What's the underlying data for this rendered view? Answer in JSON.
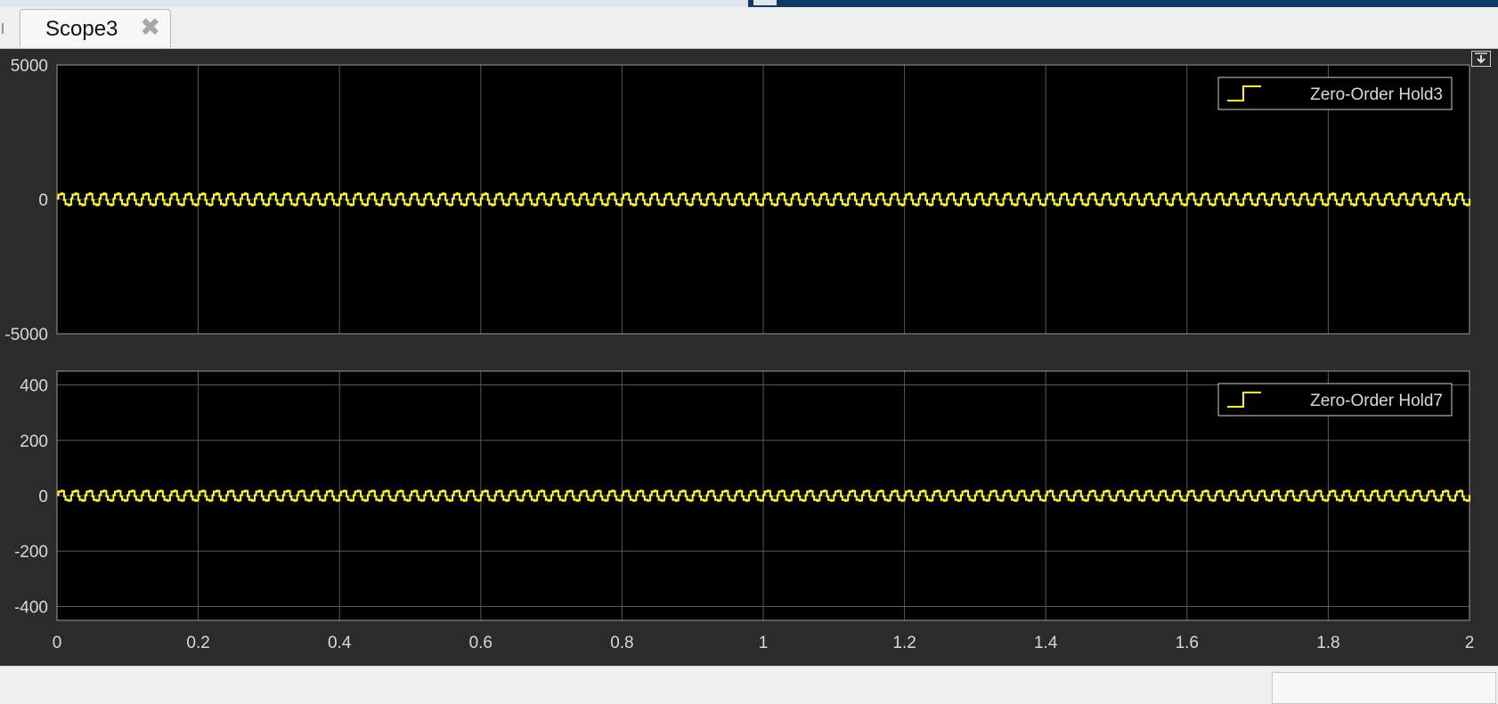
{
  "tab": {
    "title": "Scope3",
    "close_glyph": "✖"
  },
  "icons": {
    "close": "close-icon",
    "undock": "undock-icon",
    "legend_step": "step-line-icon"
  },
  "colors": {
    "plot_background": "#000000",
    "figure_background": "#2b2b2b",
    "signal": "#ffff33",
    "grid": "#5a5a5a",
    "axis_text": "#d9d9d9"
  },
  "chart_data": [
    {
      "type": "line",
      "title": "",
      "xlabel": "",
      "ylabel": "",
      "xlim": [
        0,
        2
      ],
      "ylim": [
        -5000,
        5000
      ],
      "x_ticks": [
        0,
        0.2,
        0.4,
        0.6,
        0.8,
        1,
        1.2,
        1.4,
        1.6,
        1.8,
        2
      ],
      "y_ticks": [
        5000,
        0,
        -5000
      ],
      "grid": true,
      "legend_position": "top-right",
      "series": [
        {
          "name": "Zero-Order Hold3",
          "style": "step",
          "description": "oscillation around 0",
          "amplitude": 300,
          "cycles": 100,
          "x_range": [
            0,
            2
          ]
        }
      ]
    },
    {
      "type": "line",
      "title": "",
      "xlabel": "",
      "ylabel": "",
      "xlim": [
        0,
        2
      ],
      "ylim": [
        -450,
        450
      ],
      "x_ticks": [
        0,
        0.2,
        0.4,
        0.6,
        0.8,
        1,
        1.2,
        1.4,
        1.6,
        1.8,
        2
      ],
      "x_tick_labels": [
        "0",
        "0.2",
        "0.4",
        "0.6",
        "0.8",
        "1",
        "1.2",
        "1.4",
        "1.6",
        "1.8",
        "2"
      ],
      "y_ticks": [
        400,
        200,
        0,
        -200,
        -400
      ],
      "grid": true,
      "legend_position": "top-right",
      "series": [
        {
          "name": "Zero-Order Hold7",
          "style": "step",
          "description": "oscillation around 0",
          "amplitude": 25,
          "cycles": 100,
          "x_range": [
            0,
            2
          ]
        }
      ]
    }
  ]
}
